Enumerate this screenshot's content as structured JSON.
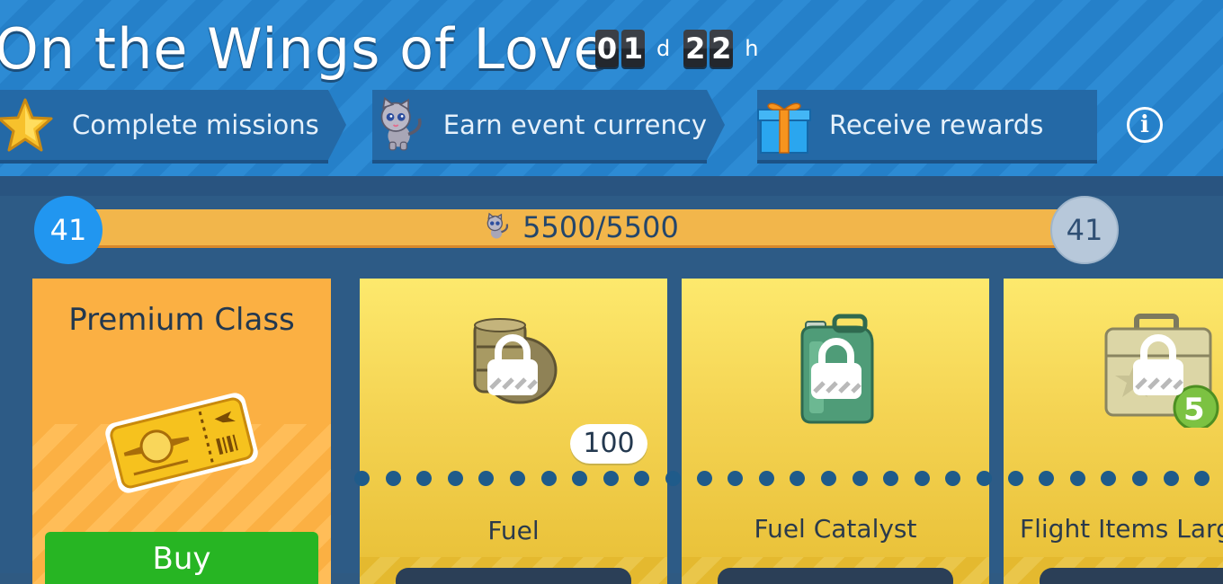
{
  "event": {
    "title": "On the Wings of Love",
    "timer": {
      "days_digits": [
        "0",
        "1"
      ],
      "days_unit": "d",
      "hours_digits": [
        "2",
        "2"
      ],
      "hours_unit": "h"
    }
  },
  "steps": [
    {
      "label": "Complete missions",
      "icon": "star-icon"
    },
    {
      "label": "Earn event currency",
      "icon": "cat-currency-icon"
    },
    {
      "label": "Receive rewards",
      "icon": "gift-icon"
    }
  ],
  "progress": {
    "current_level": "41",
    "next_level": "41",
    "text": "5500/5500",
    "value": 5500,
    "max": 5500
  },
  "premium": {
    "title": "Premium Class",
    "buy_label": "Buy",
    "icon": "golden-ticket-icon"
  },
  "rewards": [
    {
      "name": "Fuel",
      "icon": "fuel-barrel-icon",
      "locked": true,
      "amount": "100"
    },
    {
      "name": "Fuel Catalyst",
      "icon": "fuel-canister-icon",
      "locked": true
    },
    {
      "name": "Flight Items Larg",
      "icon": "flight-items-case-icon",
      "locked": true,
      "count": "5"
    }
  ],
  "colors": {
    "header": "#2d8bd4",
    "progress_fill": "#f2b64b",
    "buy_button": "#27b523",
    "level_badge": "#2196f0"
  }
}
